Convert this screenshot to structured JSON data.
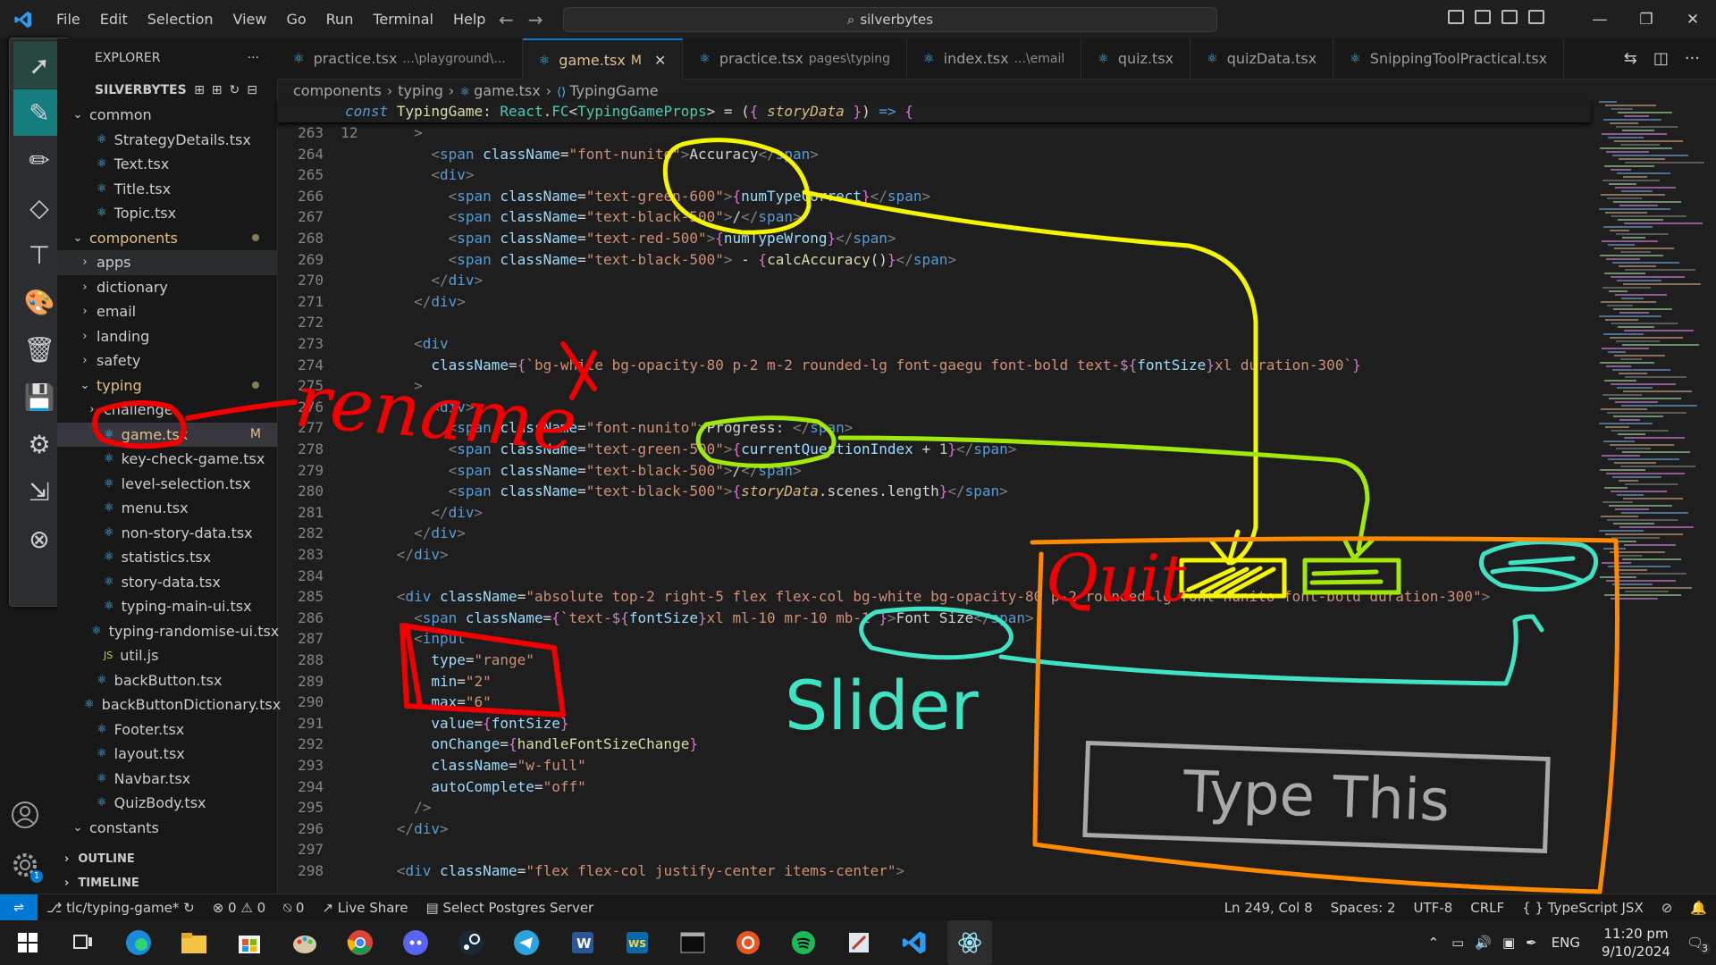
{
  "menu": [
    "File",
    "Edit",
    "Selection",
    "View",
    "Go",
    "Run",
    "Terminal",
    "Help"
  ],
  "search": "silverbytes",
  "explorer": {
    "title": "EXPLORER",
    "root": "SILVERBYTES",
    "items": [
      {
        "label": "common",
        "type": "folder-open",
        "indent": 1
      },
      {
        "label": "StrategyDetails.tsx",
        "type": "tsx",
        "indent": 2
      },
      {
        "label": "Text.tsx",
        "type": "tsx",
        "indent": 2
      },
      {
        "label": "Title.tsx",
        "type": "tsx",
        "indent": 2
      },
      {
        "label": "Topic.tsx",
        "type": "tsx",
        "indent": 2
      },
      {
        "label": "components",
        "type": "folder-open",
        "indent": 1,
        "dot": true,
        "mod": true
      },
      {
        "label": "apps",
        "type": "folder",
        "indent": 2
      },
      {
        "label": "dictionary",
        "type": "folder",
        "indent": 2
      },
      {
        "label": "email",
        "type": "folder",
        "indent": 2
      },
      {
        "label": "landing",
        "type": "folder",
        "indent": 2
      },
      {
        "label": "safety",
        "type": "folder",
        "indent": 2
      },
      {
        "label": "typing",
        "type": "folder-open",
        "indent": 2,
        "dot": true,
        "mod": true
      },
      {
        "label": "challenge",
        "type": "folder",
        "indent": 3
      },
      {
        "label": "game.tsx",
        "type": "tsx",
        "indent": 3,
        "badge": "M",
        "selected": true,
        "mod": true
      },
      {
        "label": "key-check-game.tsx",
        "type": "tsx",
        "indent": 3
      },
      {
        "label": "level-selection.tsx",
        "type": "tsx",
        "indent": 3
      },
      {
        "label": "menu.tsx",
        "type": "tsx",
        "indent": 3
      },
      {
        "label": "non-story-data.tsx",
        "type": "tsx",
        "indent": 3
      },
      {
        "label": "statistics.tsx",
        "type": "tsx",
        "indent": 3
      },
      {
        "label": "story-data.tsx",
        "type": "tsx",
        "indent": 3
      },
      {
        "label": "typing-main-ui.tsx",
        "type": "tsx",
        "indent": 3
      },
      {
        "label": "typing-randomise-ui.tsx",
        "type": "tsx",
        "indent": 3
      },
      {
        "label": "util.js",
        "type": "js",
        "indent": 3
      },
      {
        "label": "backButton.tsx",
        "type": "tsx",
        "indent": 2
      },
      {
        "label": "backButtonDictionary.tsx",
        "type": "tsx",
        "indent": 2
      },
      {
        "label": "Footer.tsx",
        "type": "tsx",
        "indent": 2
      },
      {
        "label": "layout.tsx",
        "type": "tsx",
        "indent": 2
      },
      {
        "label": "Navbar.tsx",
        "type": "tsx",
        "indent": 2
      },
      {
        "label": "QuizBody.tsx",
        "type": "tsx",
        "indent": 2
      },
      {
        "label": "constants",
        "type": "folder-open",
        "indent": 1
      }
    ],
    "outline": "OUTLINE",
    "timeline": "TIMELINE"
  },
  "tabs": [
    {
      "name": "practice.tsx",
      "desc": "...\\playground\\..."
    },
    {
      "name": "game.tsx",
      "desc": "M",
      "active": true
    },
    {
      "name": "practice.tsx",
      "desc": "pages\\typing"
    },
    {
      "name": "index.tsx",
      "desc": "...\\email"
    },
    {
      "name": "quiz.tsx",
      "desc": ""
    },
    {
      "name": "quizData.tsx",
      "desc": ""
    },
    {
      "name": "SnippingToolPractical.tsx",
      "desc": ""
    }
  ],
  "breadcrumb": [
    "components",
    "typing",
    "game.tsx",
    "TypingGame"
  ],
  "sticky": {
    "num": "12",
    "html": "<span class='t-kw'>const</span> <span class='t-fn'>TypingGame</span><span class='t-txt'>: </span><span class='t-type'>React</span><span class='t-txt'>.</span><span class='t-type'>FC</span><span class='t-txt'>&lt;</span><span class='t-type'>TypingGameProps</span><span class='t-txt'>&gt; = (</span><span class='t-brace'>{</span> <span class='t-ital'>storyData</span> <span class='t-brace'>}</span><span class='t-txt'>) </span><span class='t-kw' style='font-style:normal'>=&gt;</span> <span class='t-brace'>{</span>"
  },
  "lines": [
    {
      "n": "263",
      "html": "        <span class='t-jsx'>&gt;</span>"
    },
    {
      "n": "264",
      "html": "          <span class='t-jsx'>&lt;</span><span class='t-tag'>span</span> <span class='t-attr'>className</span>=<span class='t-str'>\"font-nunito\"</span><span class='t-jsx'>&gt;</span>Accuracy<span class='t-jsx'>&lt;/</span><span class='t-tag'>span</span><span class='t-jsx'>&gt;</span>"
    },
    {
      "n": "265",
      "html": "          <span class='t-jsx'>&lt;</span><span class='t-tag'>div</span><span class='t-jsx'>&gt;</span>"
    },
    {
      "n": "266",
      "html": "            <span class='t-jsx'>&lt;</span><span class='t-tag'>span</span> <span class='t-attr'>className</span>=<span class='t-str'>\"text-green-600\"</span><span class='t-jsx'>&gt;</span><span class='t-brace'>{</span><span class='t-var'>numTypeCorrect</span><span class='t-brace'>}</span><span class='t-jsx'>&lt;/</span><span class='t-tag'>span</span><span class='t-jsx'>&gt;</span>"
    },
    {
      "n": "267",
      "html": "            <span class='t-jsx'>&lt;</span><span class='t-tag'>span</span> <span class='t-attr'>className</span>=<span class='t-str'>\"text-black-500\"</span><span class='t-jsx'>&gt;</span>/<span class='t-jsx'>&lt;/</span><span class='t-tag'>span</span><span class='t-jsx'>&gt;</span>"
    },
    {
      "n": "268",
      "html": "            <span class='t-jsx'>&lt;</span><span class='t-tag'>span</span> <span class='t-attr'>className</span>=<span class='t-str'>\"text-red-500\"</span><span class='t-jsx'>&gt;</span><span class='t-brace'>{</span><span class='t-var'>numTypeWrong</span><span class='t-brace'>}</span><span class='t-jsx'>&lt;/</span><span class='t-tag'>span</span><span class='t-jsx'>&gt;</span>"
    },
    {
      "n": "269",
      "html": "            <span class='t-jsx'>&lt;</span><span class='t-tag'>span</span> <span class='t-attr'>className</span>=<span class='t-str'>\"text-black-500\"</span><span class='t-jsx'>&gt;</span> - <span class='t-brace'>{</span><span class='t-fn'>calcAccuracy</span>()<span class='t-brace'>}</span><span class='t-jsx'>&lt;/</span><span class='t-tag'>span</span><span class='t-jsx'>&gt;</span>"
    },
    {
      "n": "270",
      "html": "          <span class='t-jsx'>&lt;/</span><span class='t-tag'>div</span><span class='t-jsx'>&gt;</span>"
    },
    {
      "n": "271",
      "html": "        <span class='t-jsx'>&lt;/</span><span class='t-tag'>div</span><span class='t-jsx'>&gt;</span>"
    },
    {
      "n": "272",
      "html": ""
    },
    {
      "n": "273",
      "html": "        <span class='t-jsx'>&lt;</span><span class='t-tag'>div</span>"
    },
    {
      "n": "274",
      "html": "          <span class='t-attr'>className</span>=<span class='t-brace'>{</span><span class='t-str'>`bg-white bg-opacity-80 p-2 m-2 rounded-lg font-gaegu font-bold text-</span><span class='t-pink'>${</span><span class='t-var'>fontSize</span><span class='t-pink'>}</span><span class='t-str'>xl duration-300`</span><span class='t-brace'>}</span>"
    },
    {
      "n": "275",
      "html": "        <span class='t-jsx'>&gt;</span>"
    },
    {
      "n": "276",
      "html": "          <span class='t-jsx'>&lt;</span><span class='t-tag'>div</span><span class='t-jsx'>&gt;</span>"
    },
    {
      "n": "277",
      "html": "            <span class='t-jsx'>&lt;</span><span class='t-tag'>span</span> <span class='t-attr'>className</span>=<span class='t-str'>\"font-nunito\"</span><span class='t-jsx'>&gt;</span>Progress: <span class='t-jsx'>&lt;/</span><span class='t-tag'>span</span><span class='t-jsx'>&gt;</span>"
    },
    {
      "n": "278",
      "html": "            <span class='t-jsx'>&lt;</span><span class='t-tag'>span</span> <span class='t-attr'>className</span>=<span class='t-str'>\"text-green-500\"</span><span class='t-jsx'>&gt;</span><span class='t-brace'>{</span><span class='t-var'>currentQuestionIndex</span> + <span class='t-num'>1</span><span class='t-brace'>}</span><span class='t-jsx'>&lt;/</span><span class='t-tag'>span</span><span class='t-jsx'>&gt;</span>"
    },
    {
      "n": "279",
      "html": "            <span class='t-jsx'>&lt;</span><span class='t-tag'>span</span> <span class='t-attr'>className</span>=<span class='t-str'>\"text-black-500\"</span><span class='t-jsx'>&gt;</span>/<span class='t-jsx'>&lt;/</span><span class='t-tag'>span</span><span class='t-jsx'>&gt;</span>"
    },
    {
      "n": "280",
      "html": "            <span class='t-jsx'>&lt;</span><span class='t-tag'>span</span> <span class='t-attr'>className</span>=<span class='t-str'>\"text-black-500\"</span><span class='t-jsx'>&gt;</span><span class='t-brace'>{</span><span class='t-ital'>storyData</span>.scenes.length<span class='t-brace'>}</span><span class='t-jsx'>&lt;/</span><span class='t-tag'>span</span><span class='t-jsx'>&gt;</span>"
    },
    {
      "n": "281",
      "html": "          <span class='t-jsx'>&lt;/</span><span class='t-tag'>div</span><span class='t-jsx'>&gt;</span>"
    },
    {
      "n": "282",
      "html": "        <span class='t-jsx'>&lt;/</span><span class='t-tag'>div</span><span class='t-jsx'>&gt;</span>"
    },
    {
      "n": "283",
      "html": "      <span class='t-jsx'>&lt;/</span><span class='t-tag'>div</span><span class='t-jsx'>&gt;</span>"
    },
    {
      "n": "284",
      "html": ""
    },
    {
      "n": "285",
      "html": "      <span class='t-jsx'>&lt;</span><span class='t-tag'>div</span> <span class='t-attr'>className</span>=<span class='t-str'>\"absolute top-2 right-5 flex flex-col bg-white bg-opacity-80 p-2 rounded-lg font-nunito font-bold duration-300\"</span><span class='t-jsx'>&gt;</span>"
    },
    {
      "n": "286",
      "html": "        <span class='t-jsx'>&lt;</span><span class='t-tag'>span</span> <span class='t-attr'>className</span>=<span class='t-brace'>{</span><span class='t-str'>`text-</span><span class='t-pink'>${</span><span class='t-var'>fontSize</span><span class='t-pink'>}</span><span class='t-str'>xl ml-10 mr-10 mb-1`</span><span class='t-brace'>}</span><span class='t-jsx'>&gt;</span>Font Size<span class='t-jsx'>&lt;/</span><span class='t-tag'>span</span><span class='t-jsx'>&gt;</span>"
    },
    {
      "n": "287",
      "html": "        <span class='t-jsx'>&lt;</span><span class='t-tag'>input</span>"
    },
    {
      "n": "288",
      "html": "          <span class='t-attr'>type</span>=<span class='t-str'>\"range\"</span>"
    },
    {
      "n": "289",
      "html": "          <span class='t-attr'>min</span>=<span class='t-str'>\"2\"</span>"
    },
    {
      "n": "290",
      "html": "          <span class='t-attr'>max</span>=<span class='t-str'>\"6\"</span>"
    },
    {
      "n": "291",
      "html": "          <span class='t-attr'>value</span>=<span class='t-brace'>{</span><span class='t-var'>fontSize</span><span class='t-brace'>}</span>"
    },
    {
      "n": "292",
      "html": "          <span class='t-attr'>onChange</span>=<span class='t-brace'>{</span><span class='t-fn'>handleFontSizeChange</span><span class='t-brace'>}</span>"
    },
    {
      "n": "293",
      "html": "          <span class='t-attr'>className</span>=<span class='t-str'>\"w-full\"</span>"
    },
    {
      "n": "294",
      "html": "          <span class='t-attr'>autoComplete</span>=<span class='t-str'>\"off\"</span>"
    },
    {
      "n": "295",
      "html": "        <span class='t-jsx'>/&gt;</span>"
    },
    {
      "n": "296",
      "html": "      <span class='t-jsx'>&lt;/</span><span class='t-tag'>div</span><span class='t-jsx'>&gt;</span>"
    },
    {
      "n": "297",
      "html": ""
    },
    {
      "n": "298",
      "html": "      <span class='t-jsx'>&lt;</span><span class='t-tag'>div</span> <span class='t-attr'>className</span>=<span class='t-str'>\"flex flex-col justify-center items-center\"</span><span class='t-jsx'>&gt;</span>"
    }
  ],
  "status": {
    "branch": "tlc/typing-game*",
    "errors": "⊗ 0 ⚠ 0",
    "ports": "0",
    "liveshare": "Live Share",
    "postgres": "Select Postgres Server",
    "position": "Ln 249, Col 8",
    "spaces": "Spaces: 2",
    "encoding": "UTF-8",
    "eol": "CRLF",
    "language": "TypeScript JSX"
  },
  "taskbar": {
    "lang": "ENG",
    "time": "11:20 pm",
    "date": "9/10/2024",
    "notif": "3"
  },
  "annotations": {
    "rename": "rename",
    "quit": "Quit",
    "slider": "Slider",
    "type_this": "Type This"
  }
}
